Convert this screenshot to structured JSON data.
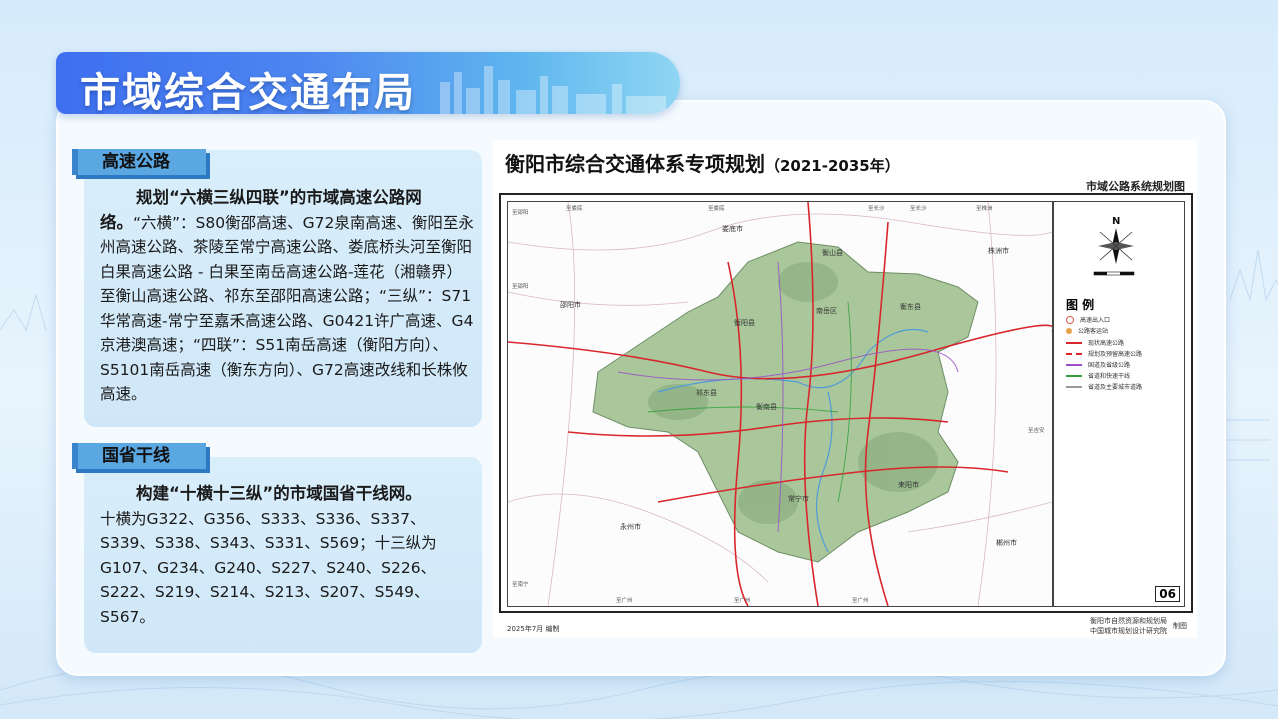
{
  "page": {
    "title": "市域综合交通布局"
  },
  "sections": [
    {
      "tag": "高速公路",
      "lead": "规划“六横三纵四联”的市域高速公路网络。",
      "body": "“六横”：S80衡邵高速、G72泉南高速、衡阳至永州高速公路、茶陵至常宁高速公路、娄底桥头河至衡阳白果高速公路 - 白果至南岳高速公路-莲花（湘赣界）至衡山高速公路、祁东至邵阳高速公路；“三纵”：S71华常高速-常宁至嘉禾高速公路、G0421许广高速、G4京港澳高速；“四联”：S51南岳高速（衡阳方向）、S5101南岳高速（衡东方向）、G72高速改线和长株攸高速。"
    },
    {
      "tag": "国省干线",
      "lead": "构建“十横十三纵”的市域国省干线网。",
      "body": "十横为G322、G356、S333、S336、S337、S339、S338、S343、S331、S569；十三纵为G107、G234、G240、S227、S240、S226、S222、S219、S214、S213、S207、S549、S567。"
    }
  ],
  "figure": {
    "title": "衡阳市综合交通体系专项规划",
    "title_years": "（2021-2035年）",
    "subtitle": "市域公路系统规划图",
    "legend_title": "图 例",
    "legend_items": [
      {
        "label": "高速出入口",
        "color": "#e25b4a"
      },
      {
        "label": "公路客运站",
        "color": "#e9a04a"
      },
      {
        "label": "现状高速公路",
        "color": "#d9262c"
      },
      {
        "label": "规划及预留高速公路",
        "color": "#d9262c"
      },
      {
        "label": "国道及省级公路",
        "color": "#9b4fc9"
      },
      {
        "label": "省道和快速干线",
        "color": "#2f9e3c"
      },
      {
        "label": "省道及主要城市道路",
        "color": "#999999"
      }
    ],
    "page_number": "06",
    "footer_date": "2025年7月    编制",
    "footer_org1": "衡阳市自然资源和规划局",
    "footer_org2": "中国城市规划设计研究院",
    "footer_made": "制图",
    "compass": "N",
    "place_labels": [
      {
        "name": "娄底市"
      },
      {
        "name": "衡山县"
      },
      {
        "name": "株洲市"
      },
      {
        "name": "邵阳市"
      },
      {
        "name": "衡阳县"
      },
      {
        "name": "衡东县"
      },
      {
        "name": "南岳区"
      },
      {
        "name": "祁东县"
      },
      {
        "name": "衡南县"
      },
      {
        "name": "永州市"
      },
      {
        "name": "常宁市"
      },
      {
        "name": "耒阳市"
      },
      {
        "name": "郴州市"
      }
    ],
    "edge_labels": [
      {
        "name": "至邵阳"
      },
      {
        "name": "至娄底"
      },
      {
        "name": "至娄底"
      },
      {
        "name": "至长沙"
      },
      {
        "name": "至长沙"
      },
      {
        "name": "至株洲"
      },
      {
        "name": "至邵阳"
      },
      {
        "name": "至吉安"
      },
      {
        "name": "至南宁"
      },
      {
        "name": "至广州"
      },
      {
        "name": "至广州"
      },
      {
        "name": "至广州"
      }
    ]
  }
}
